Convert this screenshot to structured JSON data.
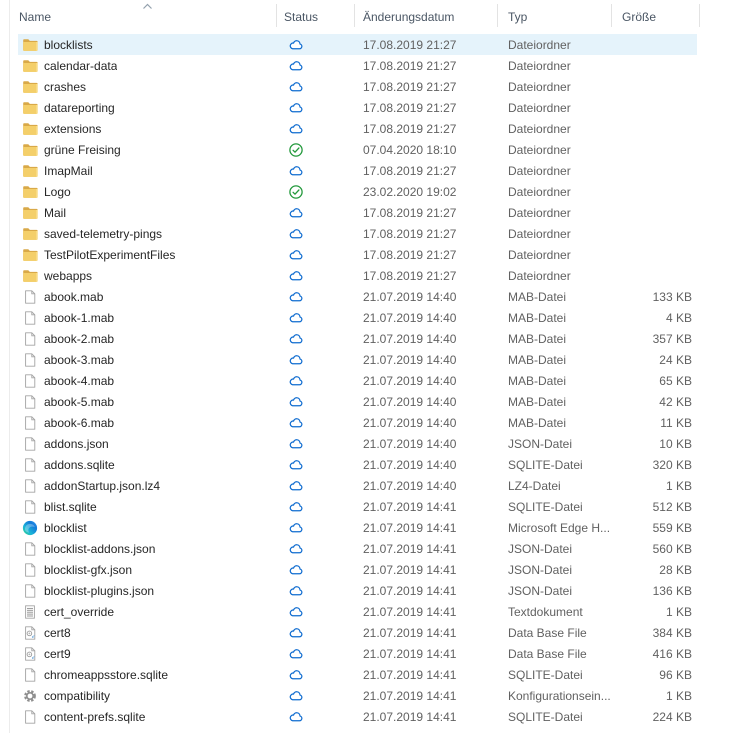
{
  "columns": [
    {
      "label": "Name"
    },
    {
      "label": "Status"
    },
    {
      "label": "Änderungsdatum"
    },
    {
      "label": "Typ"
    },
    {
      "label": "Größe"
    }
  ],
  "sort": {
    "column": "Name",
    "direction": "ascending"
  },
  "colors": {
    "selection_highlight": "#e5f3fb",
    "cloud_blue": "#0f6cd0",
    "synced_green": "#23993c",
    "folder_yellow": "#f4cf6a"
  },
  "rows": [
    {
      "name": "blocklists",
      "icon": "folder",
      "status": "online-only",
      "date": "17.08.2019 21:27",
      "type": "Dateiordner",
      "size": "",
      "selected": true
    },
    {
      "name": "calendar-data",
      "icon": "folder",
      "status": "online-only",
      "date": "17.08.2019 21:27",
      "type": "Dateiordner",
      "size": ""
    },
    {
      "name": "crashes",
      "icon": "folder",
      "status": "online-only",
      "date": "17.08.2019 21:27",
      "type": "Dateiordner",
      "size": ""
    },
    {
      "name": "datareporting",
      "icon": "folder",
      "status": "online-only",
      "date": "17.08.2019 21:27",
      "type": "Dateiordner",
      "size": ""
    },
    {
      "name": "extensions",
      "icon": "folder",
      "status": "online-only",
      "date": "17.08.2019 21:27",
      "type": "Dateiordner",
      "size": ""
    },
    {
      "name": "grüne Freising",
      "icon": "folder",
      "status": "synced",
      "date": "07.04.2020 18:10",
      "type": "Dateiordner",
      "size": ""
    },
    {
      "name": "ImapMail",
      "icon": "folder",
      "status": "online-only",
      "date": "17.08.2019 21:27",
      "type": "Dateiordner",
      "size": ""
    },
    {
      "name": "Logo",
      "icon": "folder",
      "status": "synced",
      "date": "23.02.2020 19:02",
      "type": "Dateiordner",
      "size": ""
    },
    {
      "name": "Mail",
      "icon": "folder",
      "status": "online-only",
      "date": "17.08.2019 21:27",
      "type": "Dateiordner",
      "size": ""
    },
    {
      "name": "saved-telemetry-pings",
      "icon": "folder",
      "status": "online-only",
      "date": "17.08.2019 21:27",
      "type": "Dateiordner",
      "size": ""
    },
    {
      "name": "TestPilotExperimentFiles",
      "icon": "folder",
      "status": "online-only",
      "date": "17.08.2019 21:27",
      "type": "Dateiordner",
      "size": ""
    },
    {
      "name": "webapps",
      "icon": "folder",
      "status": "online-only",
      "date": "17.08.2019 21:27",
      "type": "Dateiordner",
      "size": ""
    },
    {
      "name": "abook.mab",
      "icon": "file",
      "status": "online-only",
      "date": "21.07.2019 14:40",
      "type": "MAB-Datei",
      "size": "133 KB"
    },
    {
      "name": "abook-1.mab",
      "icon": "file",
      "status": "online-only",
      "date": "21.07.2019 14:40",
      "type": "MAB-Datei",
      "size": "4 KB"
    },
    {
      "name": "abook-2.mab",
      "icon": "file",
      "status": "online-only",
      "date": "21.07.2019 14:40",
      "type": "MAB-Datei",
      "size": "357 KB"
    },
    {
      "name": "abook-3.mab",
      "icon": "file",
      "status": "online-only",
      "date": "21.07.2019 14:40",
      "type": "MAB-Datei",
      "size": "24 KB"
    },
    {
      "name": "abook-4.mab",
      "icon": "file",
      "status": "online-only",
      "date": "21.07.2019 14:40",
      "type": "MAB-Datei",
      "size": "65 KB"
    },
    {
      "name": "abook-5.mab",
      "icon": "file",
      "status": "online-only",
      "date": "21.07.2019 14:40",
      "type": "MAB-Datei",
      "size": "42 KB"
    },
    {
      "name": "abook-6.mab",
      "icon": "file",
      "status": "online-only",
      "date": "21.07.2019 14:40",
      "type": "MAB-Datei",
      "size": "11 KB"
    },
    {
      "name": "addons.json",
      "icon": "file",
      "status": "online-only",
      "date": "21.07.2019 14:40",
      "type": "JSON-Datei",
      "size": "10 KB"
    },
    {
      "name": "addons.sqlite",
      "icon": "file",
      "status": "online-only",
      "date": "21.07.2019 14:40",
      "type": "SQLITE-Datei",
      "size": "320 KB"
    },
    {
      "name": "addonStartup.json.lz4",
      "icon": "file",
      "status": "online-only",
      "date": "21.07.2019 14:40",
      "type": "LZ4-Datei",
      "size": "1 KB"
    },
    {
      "name": "blist.sqlite",
      "icon": "file",
      "status": "online-only",
      "date": "21.07.2019 14:41",
      "type": "SQLITE-Datei",
      "size": "512 KB"
    },
    {
      "name": "blocklist",
      "icon": "edge",
      "status": "online-only",
      "date": "21.07.2019 14:41",
      "type": "Microsoft Edge H...",
      "size": "559 KB"
    },
    {
      "name": "blocklist-addons.json",
      "icon": "file",
      "status": "online-only",
      "date": "21.07.2019 14:41",
      "type": "JSON-Datei",
      "size": "560 KB"
    },
    {
      "name": "blocklist-gfx.json",
      "icon": "file",
      "status": "online-only",
      "date": "21.07.2019 14:41",
      "type": "JSON-Datei",
      "size": "28 KB"
    },
    {
      "name": "blocklist-plugins.json",
      "icon": "file",
      "status": "online-only",
      "date": "21.07.2019 14:41",
      "type": "JSON-Datei",
      "size": "136 KB"
    },
    {
      "name": "cert_override",
      "icon": "text-document",
      "status": "online-only",
      "date": "21.07.2019 14:41",
      "type": "Textdokument",
      "size": "1 KB"
    },
    {
      "name": "cert8",
      "icon": "certificate",
      "status": "online-only",
      "date": "21.07.2019 14:41",
      "type": "Data Base File",
      "size": "384 KB"
    },
    {
      "name": "cert9",
      "icon": "certificate",
      "status": "online-only",
      "date": "21.07.2019 14:41",
      "type": "Data Base File",
      "size": "416 KB"
    },
    {
      "name": "chromeappsstore.sqlite",
      "icon": "file",
      "status": "online-only",
      "date": "21.07.2019 14:41",
      "type": "SQLITE-Datei",
      "size": "96 KB"
    },
    {
      "name": "compatibility",
      "icon": "gear",
      "status": "online-only",
      "date": "21.07.2019 14:41",
      "type": "Konfigurationsein...",
      "size": "1 KB"
    },
    {
      "name": "content-prefs.sqlite",
      "icon": "file",
      "status": "online-only",
      "date": "21.07.2019 14:41",
      "type": "SQLITE-Datei",
      "size": "224 KB"
    }
  ]
}
